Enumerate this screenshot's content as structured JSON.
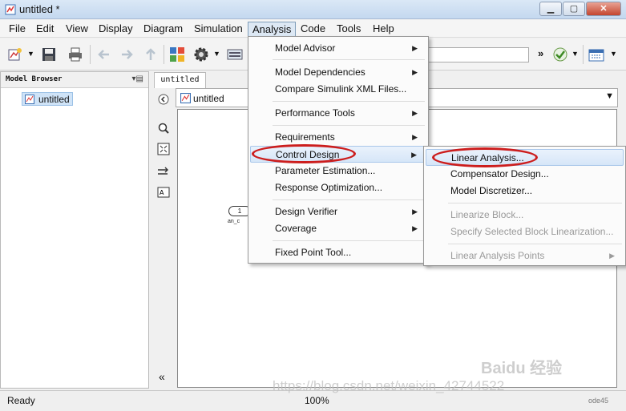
{
  "window": {
    "title": "untitled *"
  },
  "menubar": {
    "items": [
      "File",
      "Edit",
      "View",
      "Display",
      "Diagram",
      "Simulation",
      "Analysis",
      "Code",
      "Tools",
      "Help"
    ],
    "active": "Analysis"
  },
  "toolbar": {
    "chevron": "»"
  },
  "model_browser": {
    "title": "Model Browser",
    "control": "▾▤",
    "item": "untitled"
  },
  "editor": {
    "tab": "untitled",
    "path": "untitled",
    "dropdown": "▼"
  },
  "canvas": {
    "block_number": "1",
    "block_label": "an_c"
  },
  "analysis_menu": {
    "items": [
      {
        "label": "Model Advisor",
        "submenu": true
      },
      {
        "label": "Model Dependencies",
        "submenu": true
      },
      {
        "label": "Compare Simulink XML Files...",
        "submenu": false
      },
      {
        "label": "Performance Tools",
        "submenu": true
      },
      {
        "label": "Requirements",
        "submenu": true
      },
      {
        "label": "Control Design",
        "submenu": true
      },
      {
        "label": "Parameter Estimation...",
        "submenu": false
      },
      {
        "label": "Response Optimization...",
        "submenu": false
      },
      {
        "label": "Design Verifier",
        "submenu": true
      },
      {
        "label": "Coverage",
        "submenu": true
      },
      {
        "label": "Fixed Point Tool...",
        "submenu": false
      }
    ],
    "highlighted": "Control Design"
  },
  "control_design_menu": {
    "items": [
      {
        "label": "Linear Analysis...",
        "enabled": true
      },
      {
        "label": "Compensator Design...",
        "enabled": true
      },
      {
        "label": "Model Discretizer...",
        "enabled": true
      },
      {
        "label": "Linearize Block...",
        "enabled": false
      },
      {
        "label": "Specify Selected Block Linearization...",
        "enabled": false
      },
      {
        "label": "Linear Analysis Points",
        "enabled": false
      }
    ],
    "highlighted": "Linear Analysis..."
  },
  "statusbar": {
    "status": "Ready",
    "zoom": "100%",
    "right": "ode45"
  },
  "watermark": {
    "baidu": "Baidu 经验",
    "url": "https://blog.csdn.net/weixin_42744522"
  },
  "colors": {
    "annotation_red": "#cc1d1d",
    "menu_highlight": "#d6e6f8"
  }
}
